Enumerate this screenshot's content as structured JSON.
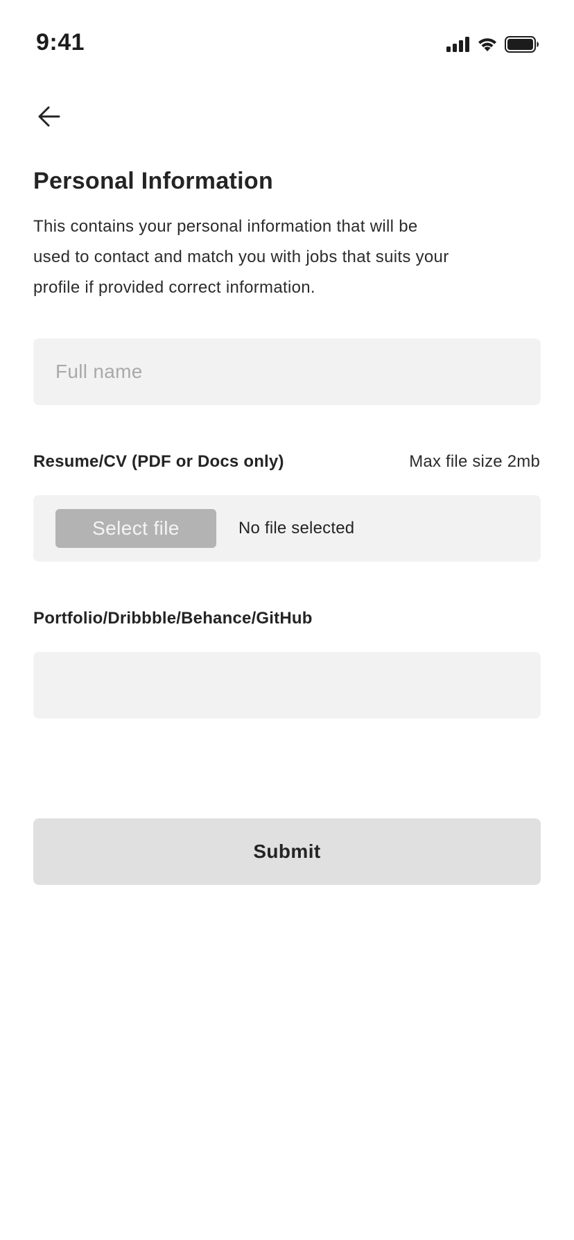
{
  "status_bar": {
    "time": "9:41",
    "icons": [
      "cellular-signal-icon",
      "wifi-icon",
      "battery-icon"
    ]
  },
  "nav": {
    "back_icon": "arrow-left-icon"
  },
  "header": {
    "title": "Personal Information",
    "description": "This contains your personal information that will be used to contact and match you with jobs that suits your profile if provided correct information."
  },
  "form": {
    "full_name": {
      "placeholder": "Full name",
      "value": ""
    },
    "resume": {
      "label": "Resume/CV (PDF or Docs only)",
      "size_note": "Max file size 2mb",
      "button_label": "Select file",
      "file_status": "No file selected"
    },
    "portfolio": {
      "label": "Portfolio/Dribbble/Behance/GitHub",
      "value": ""
    },
    "submit_label": "Submit"
  },
  "colors": {
    "text_primary": "#242424",
    "input_background": "#f2f2f2",
    "placeholder": "#a9a9a9",
    "file_button": "#b3b3b3",
    "submit_background": "#e0e0e0"
  }
}
